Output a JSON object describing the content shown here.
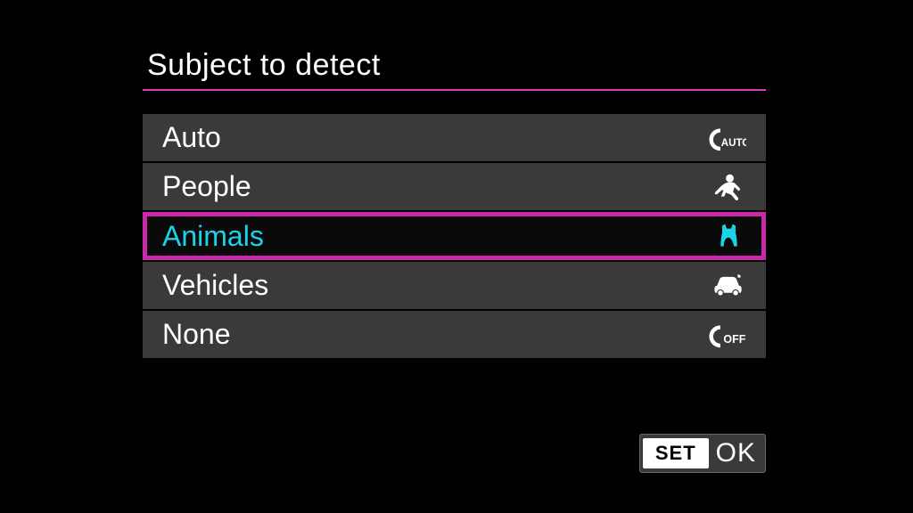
{
  "title": "Subject to detect",
  "menu": {
    "selected_index": 2,
    "items": [
      {
        "label": "Auto",
        "icon": "auto"
      },
      {
        "label": "People",
        "icon": "people"
      },
      {
        "label": "Animals",
        "icon": "animal"
      },
      {
        "label": "Vehicles",
        "icon": "vehicle"
      },
      {
        "label": "None",
        "icon": "off"
      }
    ]
  },
  "footer": {
    "set": "SET",
    "ok": "OK"
  },
  "colors": {
    "accent": "#c928a8",
    "highlight_text": "#1dd1e6",
    "row_bg": "#3a3a3a"
  }
}
